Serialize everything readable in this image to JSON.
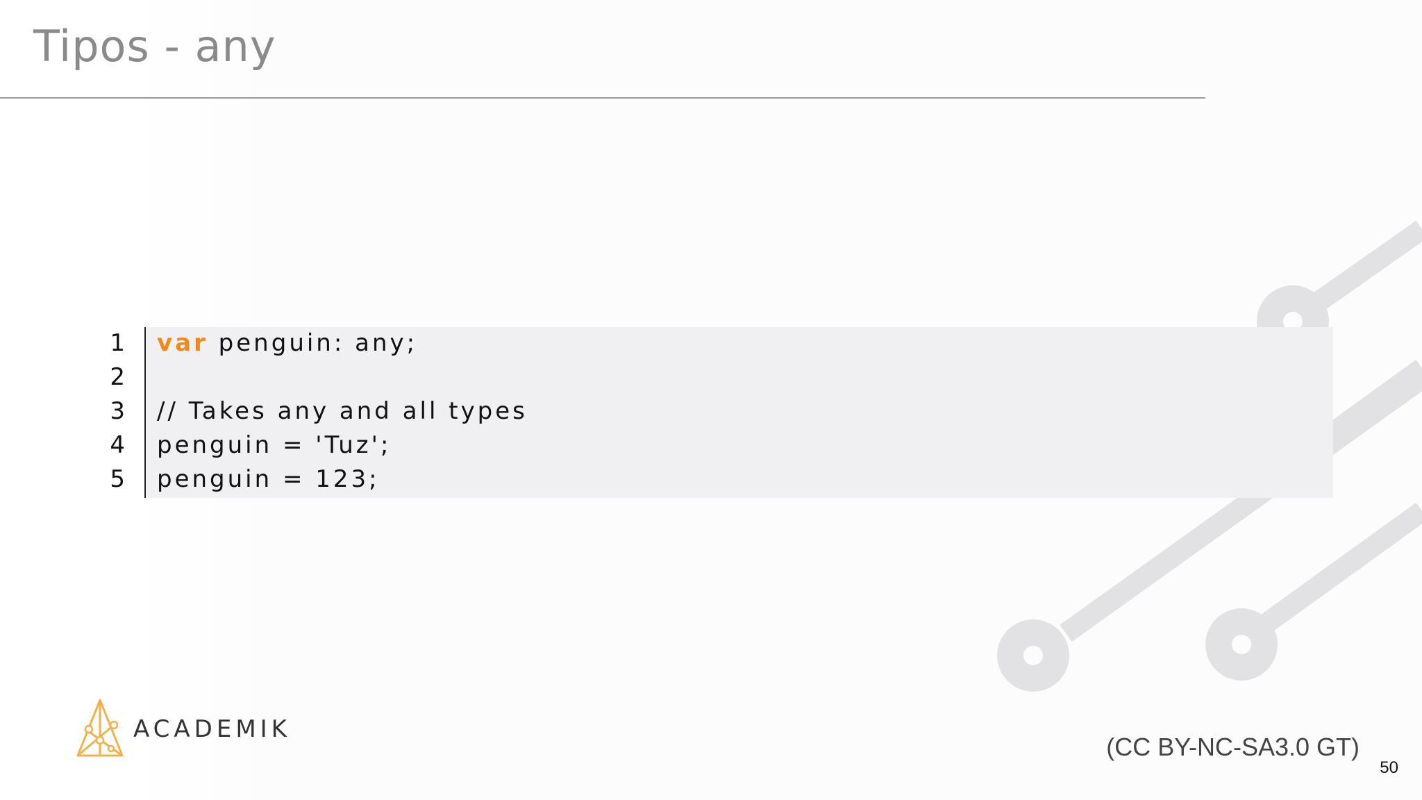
{
  "slide": {
    "title": "Tipos - any",
    "page_number": "50",
    "license": "(CC BY-NC-SA3.0 GT)"
  },
  "logo": {
    "text": "ACADEMIK",
    "accent": "#f0b14a"
  },
  "code": {
    "lines": [
      {
        "number": "1",
        "keyword": "var",
        "text": " penguin: any;"
      },
      {
        "number": "2",
        "keyword": "",
        "text": ""
      },
      {
        "number": "3",
        "keyword": "",
        "text": "// Takes any and all types"
      },
      {
        "number": "4",
        "keyword": "",
        "text": "penguin = 'Tuz';"
      },
      {
        "number": "5",
        "keyword": "",
        "text": "penguin = 123;"
      }
    ]
  },
  "colors": {
    "keyword": "#f08a1c",
    "title": "#8a8a8a",
    "circuit": "#e2e2e4",
    "code_background": "#f0eff1"
  }
}
